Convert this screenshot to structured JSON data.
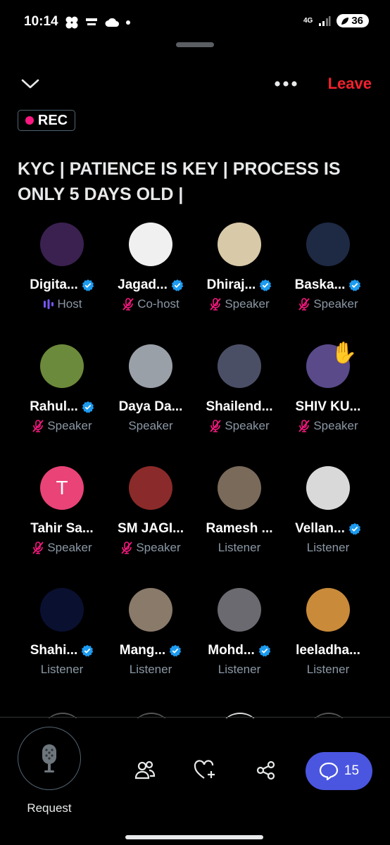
{
  "status": {
    "time": "10:14",
    "network": "4G",
    "battery": "36"
  },
  "topbar": {
    "leave_label": "Leave"
  },
  "rec_label": "REC",
  "space": {
    "title": "KYC | PATIENCE IS KEY | PROCESS IS ONLY 5 DAYS OLD |"
  },
  "participants": [
    {
      "name": "Digita...",
      "role": "Host",
      "verified": true,
      "role_icon": "equalizer-icon",
      "avatar_color": "#3a2150",
      "avatar_letter": ""
    },
    {
      "name": "Jagad...",
      "role": "Co-host",
      "verified": true,
      "role_icon": "mic-muted-icon",
      "avatar_color": "#f0f0f0",
      "avatar_letter": ""
    },
    {
      "name": "Dhiraj...",
      "role": "Speaker",
      "verified": true,
      "role_icon": "mic-muted-icon",
      "avatar_color": "#d8c9a8",
      "avatar_letter": ""
    },
    {
      "name": "Baska...",
      "role": "Speaker",
      "verified": true,
      "role_icon": "mic-muted-icon",
      "avatar_color": "#1e2a44",
      "avatar_letter": ""
    },
    {
      "name": "Rahul...",
      "role": "Speaker",
      "verified": true,
      "role_icon": "mic-muted-icon",
      "avatar_color": "#6c8a3b",
      "avatar_letter": ""
    },
    {
      "name": "Daya Da...",
      "role": "Speaker",
      "verified": false,
      "role_icon": "",
      "avatar_color": "#9aa0a8",
      "avatar_letter": ""
    },
    {
      "name": "Shailend...",
      "role": "Speaker",
      "verified": false,
      "role_icon": "mic-muted-icon",
      "avatar_color": "#4b4f66",
      "avatar_letter": ""
    },
    {
      "name": "SHIV KU...",
      "role": "Speaker",
      "verified": false,
      "role_icon": "mic-muted-icon",
      "avatar_color": "#5a4a8a",
      "avatar_letter": ""
    },
    {
      "name": "Tahir Sa...",
      "role": "Speaker",
      "verified": false,
      "role_icon": "mic-muted-icon",
      "avatar_color": "#e94377",
      "avatar_letter": "T"
    },
    {
      "name": "SM JAGI...",
      "role": "Speaker",
      "verified": false,
      "role_icon": "mic-muted-icon",
      "avatar_color": "#8b2a2a",
      "avatar_letter": ""
    },
    {
      "name": "Ramesh ...",
      "role": "Listener",
      "verified": false,
      "role_icon": "",
      "avatar_color": "#7a6a5a",
      "avatar_letter": ""
    },
    {
      "name": "Vellan...",
      "role": "Listener",
      "verified": true,
      "role_icon": "",
      "avatar_color": "#d9d9d9",
      "avatar_letter": ""
    },
    {
      "name": "Shahi...",
      "role": "Listener",
      "verified": true,
      "role_icon": "",
      "avatar_color": "#0a1030",
      "avatar_letter": ""
    },
    {
      "name": "Mang...",
      "role": "Listener",
      "verified": true,
      "role_icon": "",
      "avatar_color": "#8a7a6a",
      "avatar_letter": ""
    },
    {
      "name": "Mohd...",
      "role": "Listener",
      "verified": true,
      "role_icon": "",
      "avatar_color": "#6a6a70",
      "avatar_letter": ""
    },
    {
      "name": "leeladha...",
      "role": "Listener",
      "verified": false,
      "role_icon": "",
      "avatar_color": "#c98a3a",
      "avatar_letter": ""
    }
  ],
  "bottom": {
    "request_label": "Request",
    "comments_count": "15"
  },
  "colors": {
    "accent": "#1d9bf0",
    "leave": "#f4212e",
    "muted_mic": "#f91880",
    "comments_bg": "#4a56e0"
  }
}
